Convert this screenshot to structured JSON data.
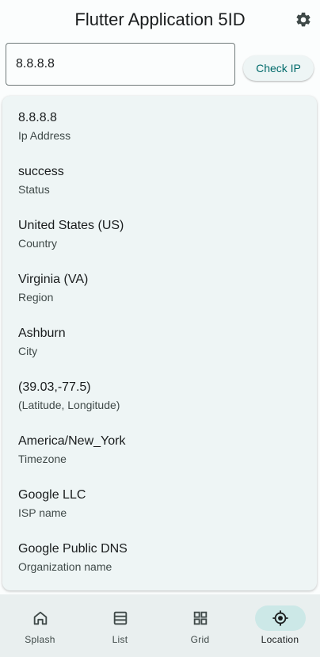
{
  "appbar": {
    "title": "Flutter Application 5ID",
    "settings_icon": "gear-icon"
  },
  "search": {
    "value": "8.8.8.8",
    "button_label": "Check IP"
  },
  "results": [
    {
      "value": "8.8.8.8",
      "label": "Ip Address"
    },
    {
      "value": "success",
      "label": "Status"
    },
    {
      "value": "United States (US)",
      "label": "Country"
    },
    {
      "value": "Virginia (VA)",
      "label": "Region"
    },
    {
      "value": "Ashburn",
      "label": "City"
    },
    {
      "value": "(39.03,-77.5)",
      "label": "(Latitude, Longitude)"
    },
    {
      "value": "America/New_York",
      "label": "Timezone"
    },
    {
      "value": "Google LLC",
      "label": "ISP name"
    },
    {
      "value": "Google Public DNS",
      "label": "Organization name"
    }
  ],
  "nav": {
    "items": [
      {
        "label": "Splash",
        "icon": "home-icon"
      },
      {
        "label": "List",
        "icon": "list-icon"
      },
      {
        "label": "Grid",
        "icon": "grid-icon"
      },
      {
        "label": "Location",
        "icon": "location-target-icon"
      }
    ],
    "active": "Location"
  },
  "colors": {
    "accent": "#006a6a",
    "indicator": "#cce8e7",
    "card": "#eef5f5",
    "navbar": "#e9efef"
  }
}
